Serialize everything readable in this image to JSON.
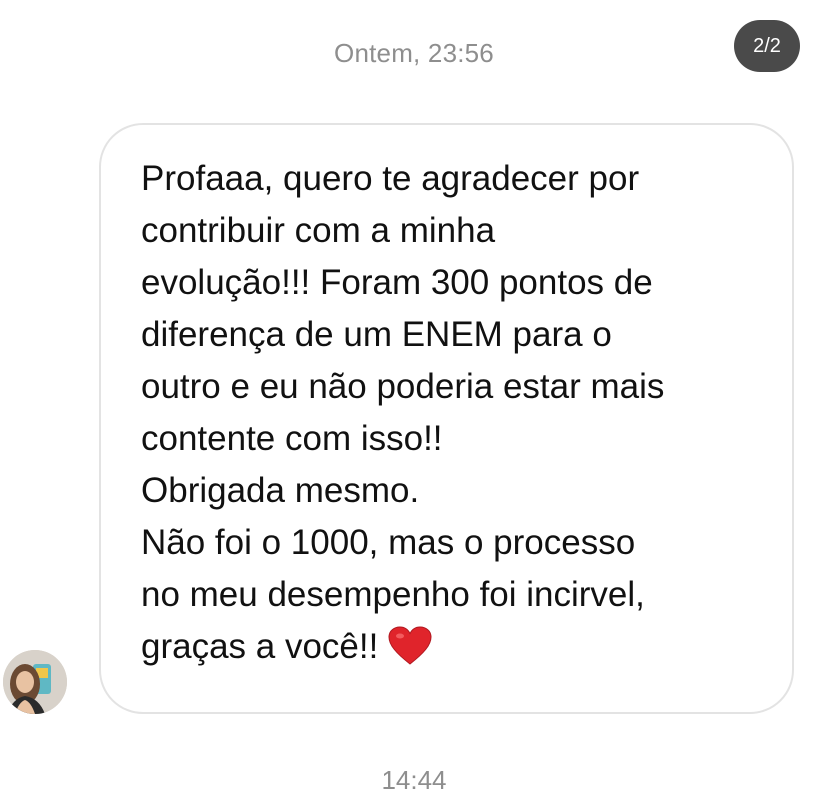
{
  "header": {
    "timestamp": "Ontem, 23:56",
    "page_indicator": "2/2"
  },
  "message": {
    "lines": [
      "Profaaa, quero te agradecer por",
      "contribuir com a minha",
      "evolução!!! Foram 300 pontos de",
      "diferença de um ENEM para o",
      "outro e eu não poderia estar mais",
      "contente com isso!!",
      "Obrigada mesmo.",
      "Não foi o 1000, mas o processo",
      "no meu desempenho foi incirvel,",
      "graças a você!!"
    ],
    "emoji": "heart-icon"
  },
  "footer": {
    "timestamp": "14:44"
  },
  "colors": {
    "timestamp": "#8e8e8e",
    "indicator_bg": "#4a4a4a",
    "bubble_border": "#e3e3e3",
    "heart": "#e0242b"
  }
}
